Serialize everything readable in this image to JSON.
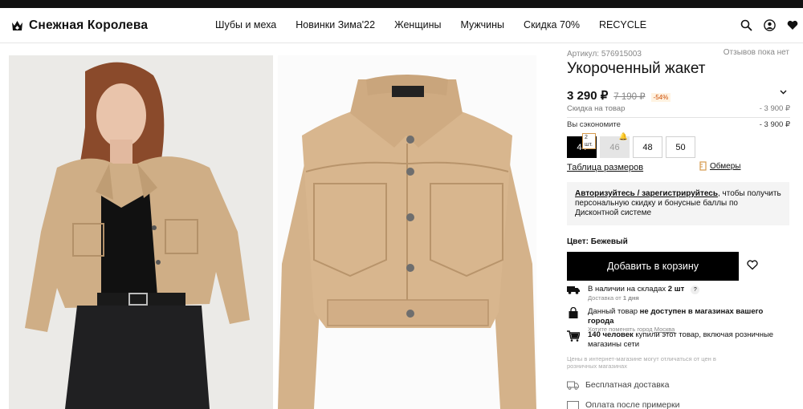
{
  "header": {
    "logo_text": "Снежная Королева",
    "nav": [
      "Шубы и меха",
      "Новинки Зима'22",
      "Женщины",
      "Мужчины",
      "Скидка 70%",
      "RECYCLE"
    ]
  },
  "product": {
    "article": "Артикул: 576915003",
    "reviews": "Отзывов пока нет",
    "title": "Укороченный жакет",
    "price": "3 290 ₽",
    "old_price": "7 190 ₽",
    "discount_badge": "-54%",
    "discount_label": "Скидка на товар",
    "discount_value": "- 3 900 ₽",
    "saved_label": "Вы сэкономите",
    "saved_value": "- 3 900 ₽",
    "sizes": [
      "44",
      "46",
      "48",
      "50"
    ],
    "stock_badge": "2 шт.",
    "size_chart": "Таблица размеров",
    "measurements": "Обмеры",
    "login_link": "Авторизуйтесь / зарегистрируйтесь",
    "login_text": ", чтобы получить персональную скидку и бонусные баллы по Дисконтной системе",
    "color_label": "Цвет:",
    "color_value": "Бежевый",
    "cart_button": "Добавить в корзину",
    "availability_text": "В наличии на складах",
    "availability_qty": "2 шт",
    "availability_q": "?",
    "delivery_prefix": "Доставка от",
    "delivery_days": "1 дня",
    "store_prefix": "Данный товар",
    "store_bold": "не доступен в магазинах вашего города",
    "change_city_prefix": "Хотите поменять город",
    "city": "Москва",
    "buyers_count": "140 человек",
    "buyers_text": "купили этот товар, включая розничные магазины сети",
    "price_note": "Цены в интернет-магазине могут отличаться от цен в розничных магазинах",
    "free_delivery": "Бесплатная доставка",
    "pay_after": "Оплата после примерки"
  }
}
